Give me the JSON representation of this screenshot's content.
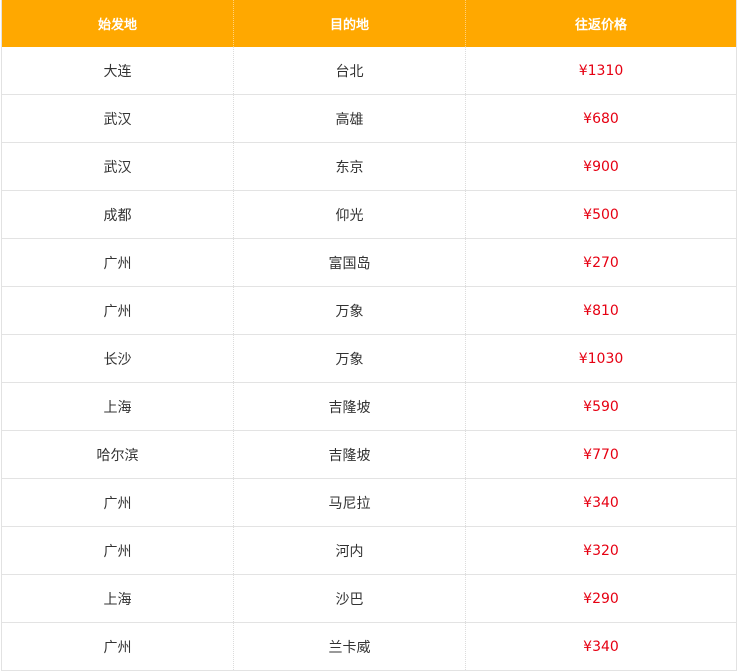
{
  "table": {
    "headers": {
      "origin": "始发地",
      "destination": "目的地",
      "price": "往返价格"
    },
    "rows": [
      {
        "origin": "大连",
        "destination": "台北",
        "price": "¥1310"
      },
      {
        "origin": "武汉",
        "destination": "高雄",
        "price": "¥680"
      },
      {
        "origin": "武汉",
        "destination": "东京",
        "price": "¥900"
      },
      {
        "origin": "成都",
        "destination": "仰光",
        "price": "¥500"
      },
      {
        "origin": "广州",
        "destination": "富国岛",
        "price": "¥270"
      },
      {
        "origin": "广州",
        "destination": "万象",
        "price": "¥810"
      },
      {
        "origin": "长沙",
        "destination": "万象",
        "price": "¥1030"
      },
      {
        "origin": "上海",
        "destination": "吉隆坡",
        "price": "¥590"
      },
      {
        "origin": "哈尔滨",
        "destination": "吉隆坡",
        "price": "¥770"
      },
      {
        "origin": "广州",
        "destination": "马尼拉",
        "price": "¥340"
      },
      {
        "origin": "广州",
        "destination": "河内",
        "price": "¥320"
      },
      {
        "origin": "上海",
        "destination": "沙巴",
        "price": "¥290"
      },
      {
        "origin": "广州",
        "destination": "兰卡威",
        "price": "¥340"
      }
    ]
  },
  "colors": {
    "header_bg": "#ffa800",
    "header_text": "#ffffff",
    "price_text": "#e60012",
    "body_text": "#333333"
  }
}
